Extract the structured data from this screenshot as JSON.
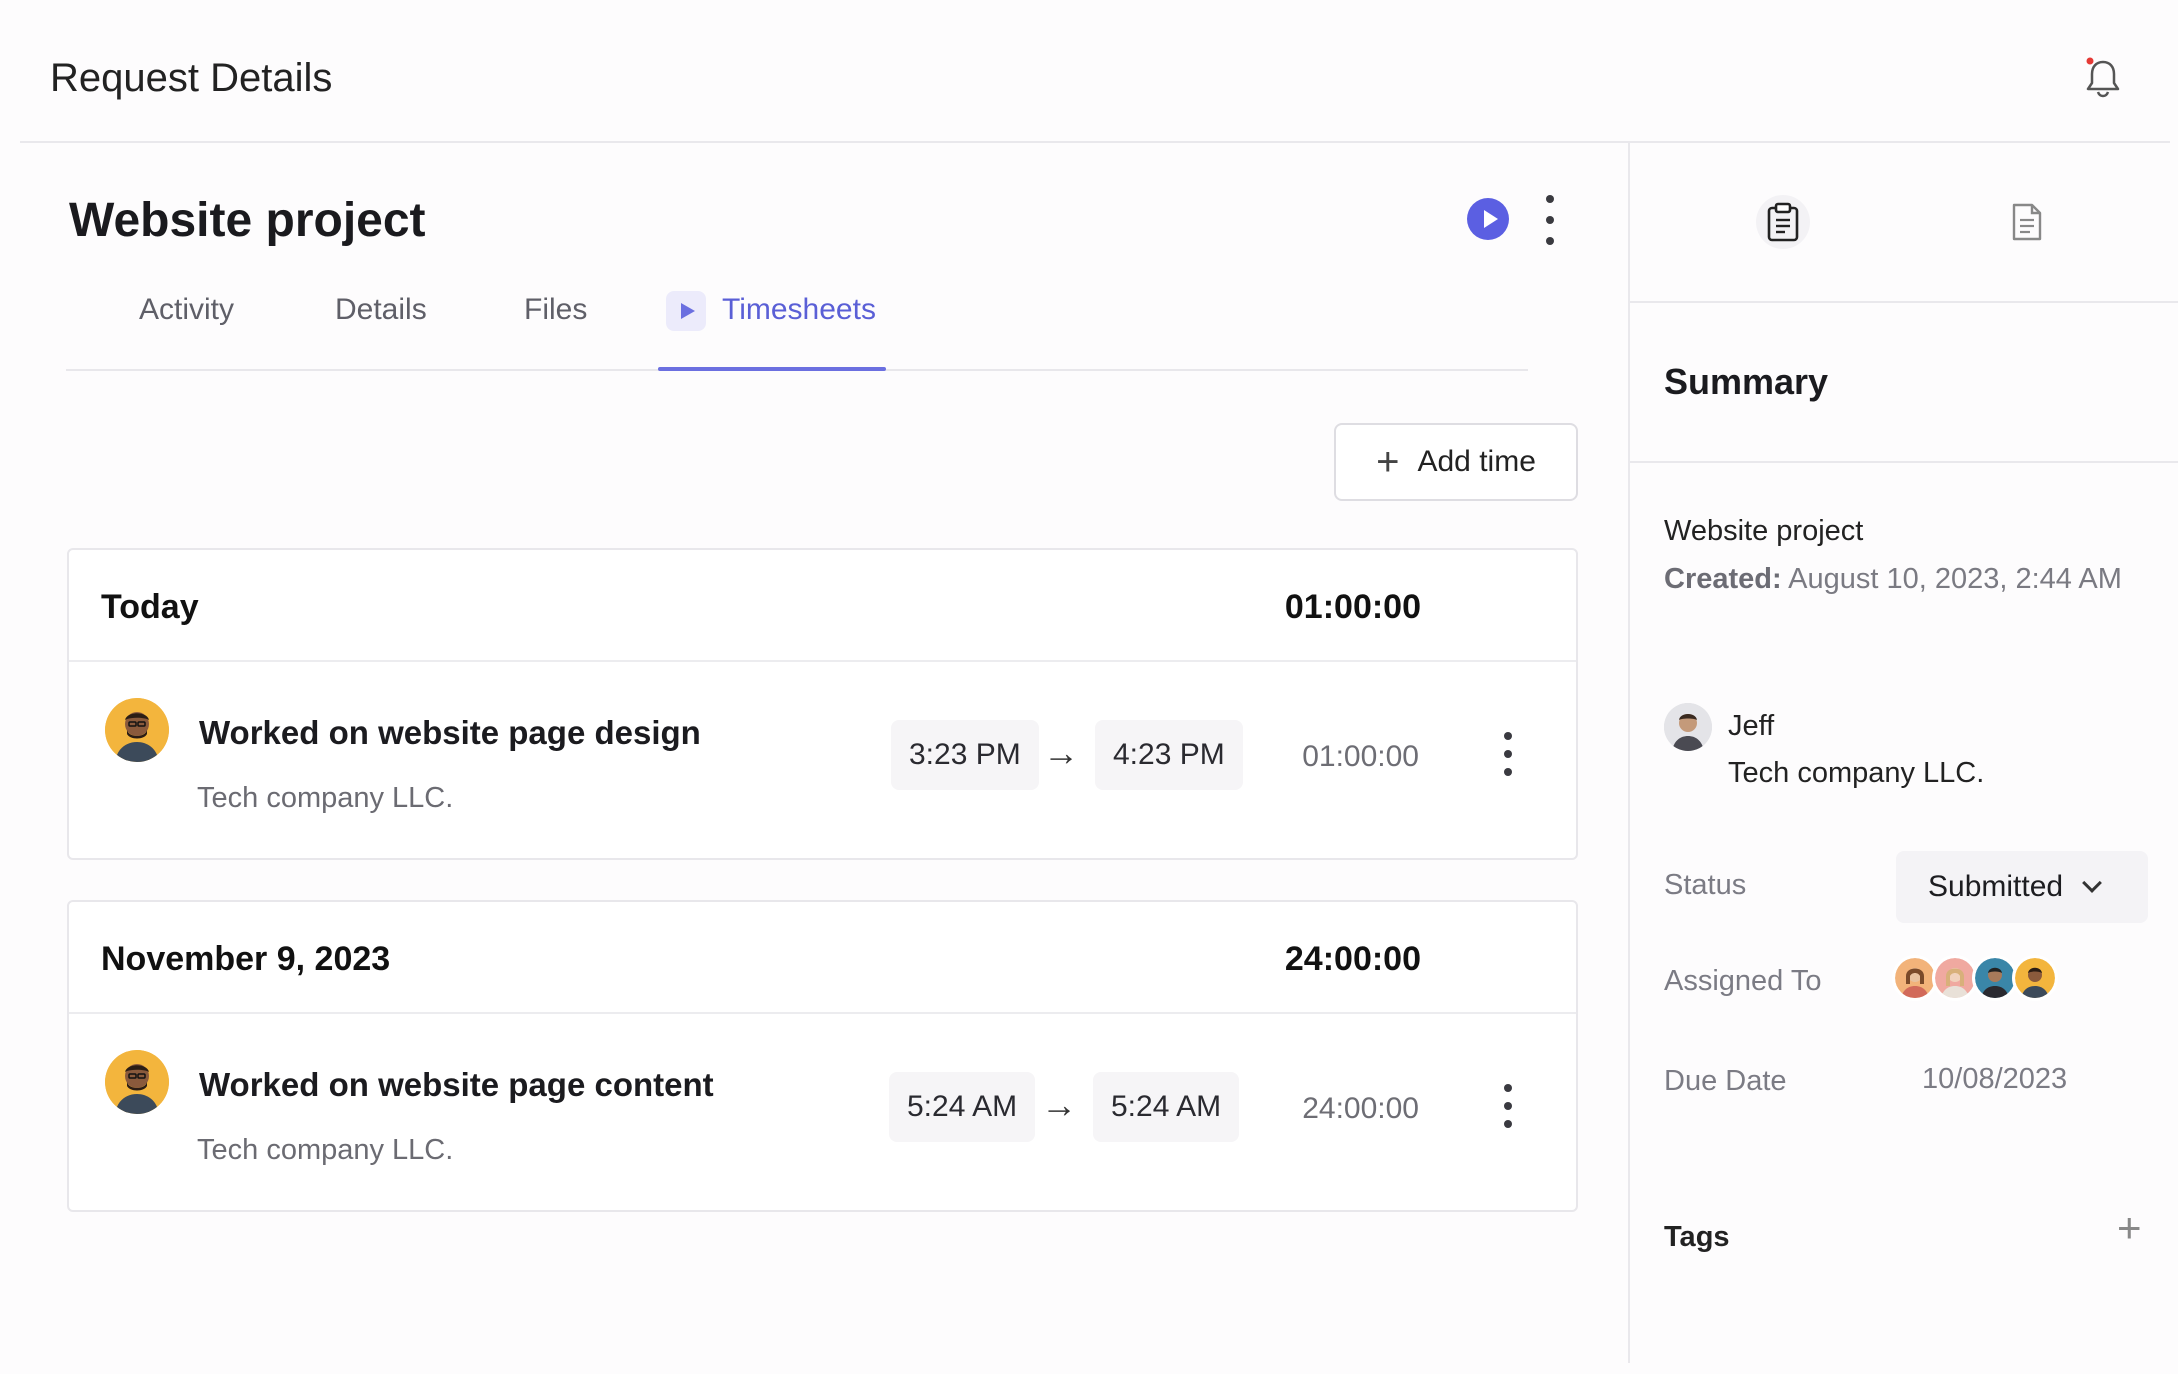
{
  "header": {
    "title": "Request Details"
  },
  "project": {
    "title": "Website project"
  },
  "tabs": [
    {
      "label": "Activity"
    },
    {
      "label": "Details"
    },
    {
      "label": "Files"
    },
    {
      "label": "Timesheets",
      "active": true
    }
  ],
  "toolbar": {
    "add_time_label": "Add time",
    "add_time_icon": "plus-icon"
  },
  "timesheets": [
    {
      "date": "Today",
      "total": "01:00:00",
      "entries": [
        {
          "title": "Worked on website page design",
          "company": "Tech company LLC.",
          "start": "3:23 PM",
          "arrow": "→",
          "end": "4:23 PM",
          "duration": "01:00:00"
        }
      ]
    },
    {
      "date": "November 9, 2023",
      "total": "24:00:00",
      "entries": [
        {
          "title": "Worked on website page content",
          "company": "Tech company LLC.",
          "start": "5:24 AM",
          "arrow": "→",
          "end": "5:24 AM",
          "duration": "24:00:00"
        }
      ]
    }
  ],
  "summary": {
    "title": "Summary",
    "project": "Website project",
    "created_label": "Created:",
    "created_value": "August 10, 2023, 2:44 AM",
    "user": "Jeff",
    "company": "Tech company LLC.",
    "status_label": "Status",
    "status_value": "Submitted",
    "assigned_label": "Assigned To",
    "due_label": "Due Date",
    "due_value": "10/08/2023",
    "tags_label": "Tags",
    "tags_add": "+"
  },
  "colors": {
    "accent": "#5b5fe2",
    "notification_dot": "#e53935",
    "avatar_bg": "#f3b53d"
  }
}
